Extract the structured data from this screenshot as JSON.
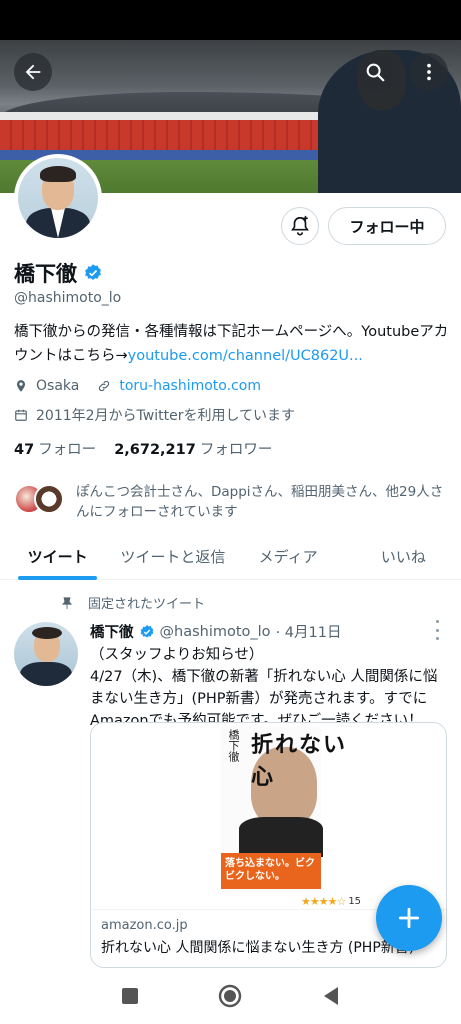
{
  "banner": {
    "back_icon": "back-arrow-icon",
    "search_icon": "search-icon",
    "more_icon": "more-vertical-icon"
  },
  "profile": {
    "name": "橋下徹",
    "handle": "@hashimoto_lo",
    "verified": true,
    "follow_button": "フォロー中",
    "bell_icon": "notification-bell-plus-icon",
    "bio_text": "橋下徹からの発信・各種情報は下記ホームページへ。Youtubeアカウントはこちら→",
    "bio_link": "youtube.com/channel/UC862U...",
    "location": "Osaka",
    "website": "toru-hashimoto.com",
    "joined": "2011年2月からTwitterを利用しています",
    "following_count": "47",
    "following_label": "フォロー",
    "followers_count": "2,672,217",
    "followers_label": "フォロワー",
    "followed_by": "ぽんこつ会計士さん、Dappiさん、稲田朋美さん、他29人さんにフォローされています"
  },
  "tabs": [
    {
      "label": "ツイート",
      "active": true
    },
    {
      "label": "ツイートと返信",
      "active": false
    },
    {
      "label": "メディア",
      "active": false
    },
    {
      "label": "いいね",
      "active": false
    }
  ],
  "tweet": {
    "pinned_label": "固定されたツイート",
    "author_name": "橋下徹",
    "author_handle": "@hashimoto_lo",
    "date": "· 4月11日",
    "text": "（スタッフよりお知らせ）\n4/27（木)、橋下徹の新著「折れない心 人間関係に悩まない生き方」(PHP新書）が発売されます。すでにAmazonでも予約可能です。ぜひご一読ください！",
    "card": {
      "book_author_vertical": "橋下徹",
      "book_title": "折れない心",
      "book_band": "落ち込まない。ビクビクしない。",
      "rating_stars": "★★★★☆",
      "rating_count": "15",
      "domain": "amazon.co.jp",
      "title": "折れない心 人間関係に悩まない生き方 (PHP新書)"
    }
  },
  "fab": {
    "icon": "compose-plus-icon"
  },
  "navbar": {
    "items": [
      "recents-square-icon",
      "home-circle-icon",
      "back-triangle-icon"
    ]
  },
  "colors": {
    "accent": "#1d9bf0",
    "text": "#0f1419",
    "secondary": "#536471"
  }
}
